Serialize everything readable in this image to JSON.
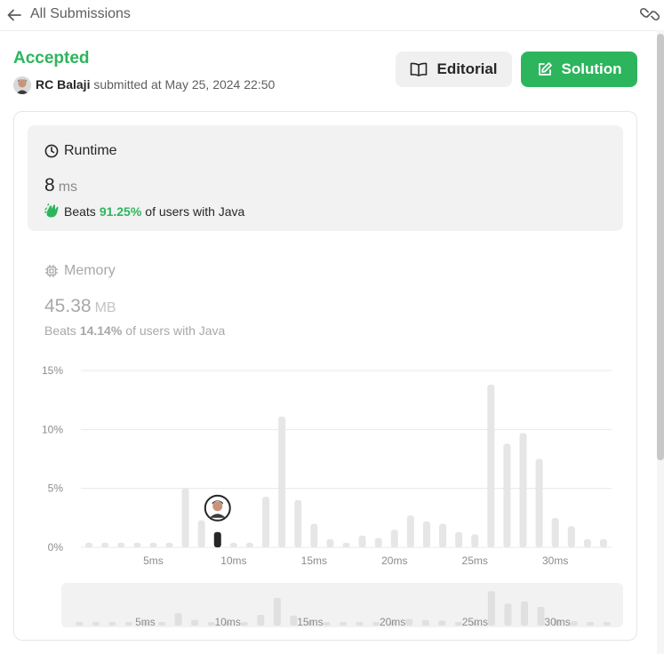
{
  "header": {
    "back_label": "All Submissions"
  },
  "submission": {
    "status": "Accepted",
    "user_name": "RC Balaji",
    "submitted_text": "submitted at May 25, 2024 22:50"
  },
  "buttons": {
    "editorial": "Editorial",
    "solution": "Solution"
  },
  "runtime": {
    "title": "Runtime",
    "value": "8",
    "unit": "ms",
    "beats_prefix": "Beats",
    "beats_percent": "91.25%",
    "beats_suffix": "of users with Java"
  },
  "memory": {
    "title": "Memory",
    "value": "45.38",
    "unit": "MB",
    "beats_prefix": "Beats",
    "beats_percent": "14.14%",
    "beats_suffix": "of users with Java"
  },
  "colors": {
    "accent_green": "#2db55d",
    "bar": "#e6e6e6",
    "bar_highlight": "#262626",
    "panel_bg": "#f2f2f2"
  },
  "chart_data": {
    "type": "bar",
    "title": "",
    "xlabel": "",
    "ylabel": "",
    "ylim": [
      0,
      15
    ],
    "y_ticks": [
      "0%",
      "5%",
      "10%",
      "15%"
    ],
    "x_ticks": [
      "5ms",
      "10ms",
      "15ms",
      "20ms",
      "25ms",
      "30ms"
    ],
    "x_tick_values": [
      5,
      10,
      15,
      20,
      25,
      30
    ],
    "x": [
      1,
      2,
      3,
      4,
      5,
      6,
      7,
      8,
      9,
      10,
      11,
      12,
      13,
      14,
      15,
      16,
      17,
      18,
      19,
      20,
      21,
      22,
      23,
      24,
      25,
      26,
      27,
      28,
      29,
      30,
      31,
      32
    ],
    "values": [
      0.4,
      0.4,
      0.4,
      0.4,
      0.4,
      0.4,
      5.0,
      2.3,
      1.3,
      0.4,
      0.4,
      4.3,
      11.1,
      4.0,
      2.0,
      0.7,
      0.4,
      1.0,
      0.8,
      1.5,
      2.7,
      2.2,
      2.0,
      1.3,
      1.1,
      13.8,
      8.8,
      9.7,
      7.5,
      2.5,
      1.8,
      0.7,
      0.7
    ],
    "highlight_x": 9,
    "grid": true
  },
  "minimap_data": {
    "x_ticks": [
      "5ms",
      "10ms",
      "15ms",
      "20ms",
      "25ms",
      "30ms"
    ]
  }
}
